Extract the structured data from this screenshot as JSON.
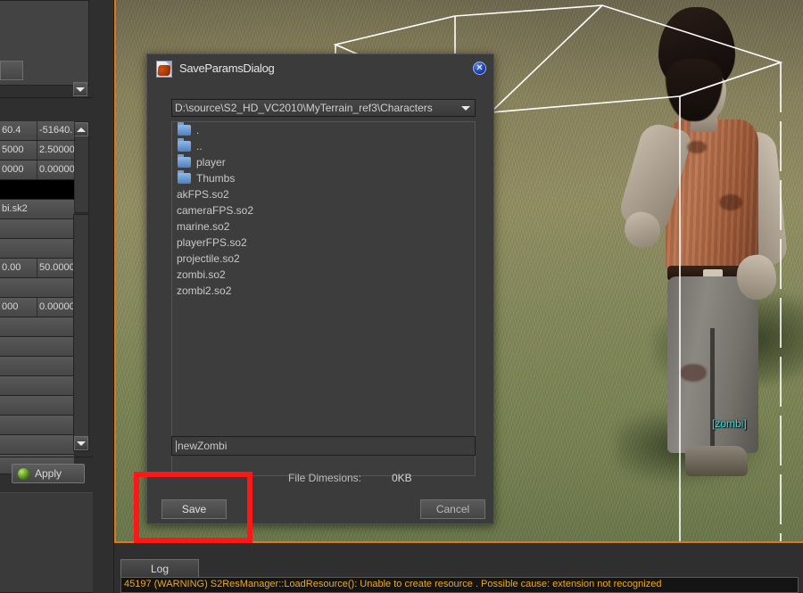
{
  "viewport": {
    "object_label": "[zombi]",
    "border_color": "#e0761c",
    "selection_box": "wireframe-bounding-box"
  },
  "left_panel": {
    "property_rows": [
      [
        "60.4",
        "-51640."
      ],
      [
        "5000",
        "2.50000"
      ],
      [
        "0000",
        "0.00000"
      ],
      [
        "",
        ""
      ],
      [
        "bi.sk2",
        ""
      ],
      [
        "",
        ""
      ],
      [
        "",
        ""
      ],
      [
        "0.00",
        "50.0000"
      ],
      [
        "",
        ""
      ],
      [
        "000",
        "0.00000"
      ]
    ],
    "apply_label": "Apply",
    "scroll_up_icon": "arrow-up-icon",
    "scroll_down_icon": "arrow-down-icon"
  },
  "dialog": {
    "title": "SaveParamsDialog",
    "icon": "s2-document-icon",
    "close_label": "✕",
    "path": "D:\\source\\S2_HD_VC2010\\MyTerrain_ref3\\Characters",
    "folders": [
      ".",
      "..",
      "player",
      "Thumbs"
    ],
    "files": [
      "akFPS.so2",
      "cameraFPS.so2",
      "marine.so2",
      "playerFPS.so2",
      "projectile.so2",
      "zombi.so2",
      "zombi2.so2"
    ],
    "filename_value": "newZombi",
    "dimensions_label": "File Dimesions:",
    "dimensions_value": "0KB",
    "save_label": "Save",
    "cancel_label": "Cancel"
  },
  "annotation": {
    "color": "#ff1616",
    "target": "save-button"
  },
  "log": {
    "tab_label": "Log",
    "line": "45197 (WARNING) S2ResManager::LoadResource(): Unable to create resource . Possible cause: extension not recognized"
  }
}
